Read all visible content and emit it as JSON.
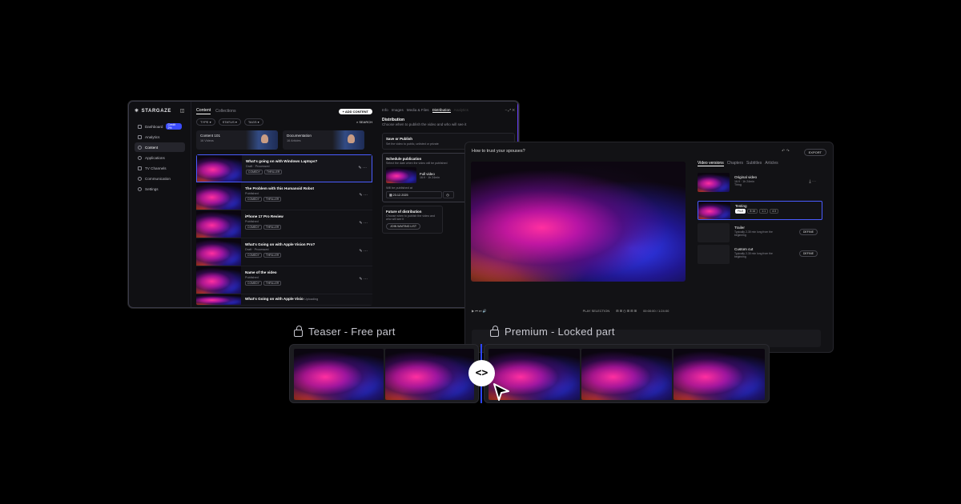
{
  "app": {
    "logo": "STARGAZE",
    "sidebar": [
      {
        "label": "Dashboard",
        "badge": "Credit 2%"
      },
      {
        "label": "Analytics"
      },
      {
        "label": "Content",
        "active": true
      },
      {
        "label": "Applications"
      },
      {
        "label": "TV Channels"
      },
      {
        "label": "Communication"
      },
      {
        "label": "Settings"
      }
    ]
  },
  "content": {
    "tabs": [
      "Content",
      "Collections"
    ],
    "add_button": "+ ADD CONTENT",
    "filters": [
      "TYPE",
      "STATUS",
      "TAGS"
    ],
    "search": "SEARCH",
    "cards": [
      {
        "title": "Content 101",
        "sub": "16 Videos"
      },
      {
        "title": "Documentation",
        "sub": "16 Articles"
      }
    ],
    "rows": [
      {
        "title": "What's going on with Windows Laptops?",
        "status": "Draft · Processed",
        "tags": [
          "COMEDY",
          "THRILLER"
        ]
      },
      {
        "title": "The Problem with this Humanoid Robot",
        "status": "Published",
        "tags": [
          "COMEDY",
          "THRILLER"
        ]
      },
      {
        "title": "iPhone 17 Pro Review",
        "status": "Published",
        "tags": [
          "COMEDY",
          "THRILLER"
        ]
      },
      {
        "title": "What's Going on with Apple Vision Pro?",
        "status": "Draft · Processed",
        "tags": [
          "COMEDY",
          "THRILLER"
        ]
      },
      {
        "title": "Name of the video",
        "status": "Published",
        "tags": [
          "COMEDY",
          "THRILLER"
        ]
      },
      {
        "title": "What's Going on with Apple Visio",
        "status": "Uploading",
        "tags": []
      }
    ]
  },
  "distribution": {
    "tabs": [
      "Info",
      "Images",
      "Media & Files",
      "Distribution",
      "Analytics"
    ],
    "heading": "Distribution",
    "description": "Choose when to publish the video and who will see it",
    "save_title": "Save or Publish",
    "save_desc": "Set the video to public, unlisted or private",
    "schedule_title": "Schedule publication",
    "schedule_desc": "Select the date when the video will be published",
    "schedule_item_title": "Full video",
    "schedule_item_sub": "16:9 · 1h 24min",
    "published_at_label": "Will be published at",
    "date": "23.12.2025",
    "future_title": "Future of distribution",
    "future_desc": "Choose when to publish the video and who will see it",
    "waiting_button": "JOIN WAITING LIST"
  },
  "editor": {
    "title": "How to trust your spouses?",
    "export": "EXPORT",
    "tabs": [
      "Video versions",
      "Chapters",
      "Subtitles",
      "Articles"
    ],
    "versions": [
      {
        "title": "Original video",
        "sub": "16:9 · 1h 24min",
        "extra": "Tiring"
      },
      {
        "title": "Testing",
        "res": [
          "FILE",
          "8:16",
          "1:1",
          "4:3"
        ]
      },
      {
        "title": "Trailer",
        "sub": "Typically 2-30 min long from the beginning",
        "button": "DEFINE"
      },
      {
        "title": "Custom cut",
        "sub": "Typically 2-30 min long from the beginning",
        "button": "DEFINE"
      }
    ],
    "play_selection": "PLAY SELECTION",
    "timecode": "00:00:00 / 1:24:00"
  },
  "strip": {
    "teaser_label": "Teaser - Free part",
    "premium_label": "Premium - Locked part",
    "handle_symbol": "<>"
  },
  "colors": {
    "accent": "#2d45ff",
    "pink": "#ff2fa0",
    "bg": "#000000"
  }
}
